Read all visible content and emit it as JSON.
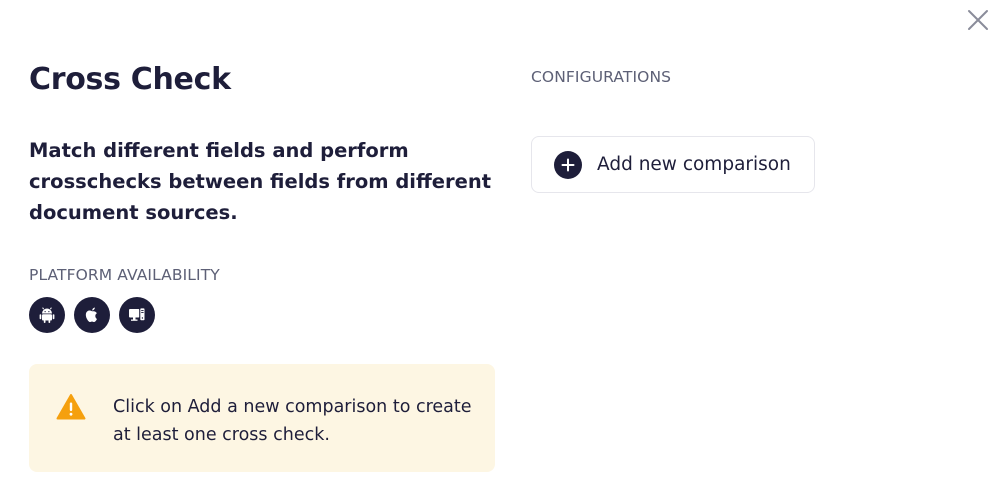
{
  "title": "Cross Check",
  "description": "Match different fields and perform crosschecks between fields from different document sources.",
  "platform": {
    "label": "PLATFORM AVAILABILITY",
    "icons": [
      "android-icon",
      "apple-icon",
      "desktop-mobile-icon"
    ]
  },
  "notice": {
    "text": "Click on Add a new comparison to create at least one cross check.",
    "icon": "warning-icon",
    "background": "#fdf6e3",
    "icon_color": "#f5a00e"
  },
  "configurations": {
    "label": "CONFIGURATIONS",
    "add_button_label": "Add new comparison",
    "add_icon": "plus-icon"
  },
  "close_icon": "close-icon",
  "colors": {
    "primary": "#1e1e3a",
    "muted": "#5d6076",
    "border": "#e6e6ec"
  }
}
